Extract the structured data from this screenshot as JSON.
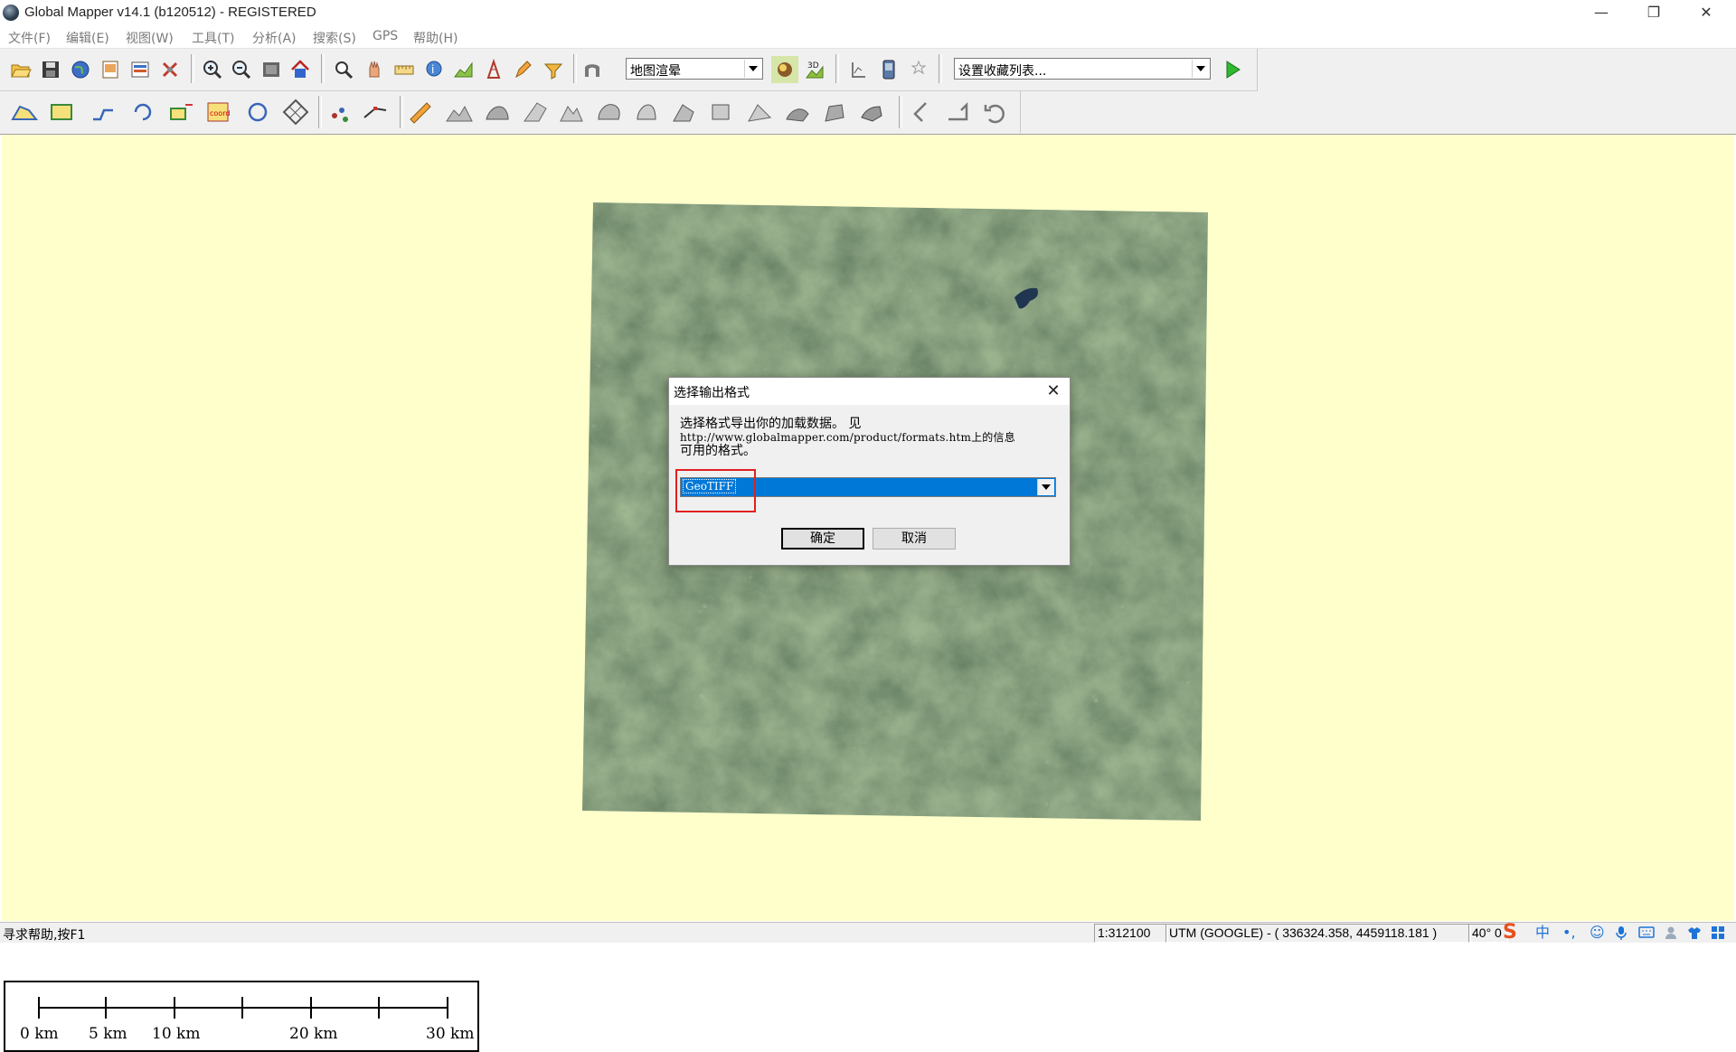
{
  "window": {
    "title": "Global Mapper v14.1 (b120512) - REGISTERED",
    "minimize": "—",
    "restore": "❐",
    "close": "✕"
  },
  "menu": [
    "文件(F)",
    "编辑(E)",
    "视图(W)",
    "工具(T)",
    "分析(A)",
    "搜索(S)",
    "GPS",
    "帮助(H)"
  ],
  "toolbar": {
    "render_combo": "地图渲晕",
    "favorites_combo": "设置收藏列表..."
  },
  "scalebar": {
    "labels": [
      "0 km",
      "5 km",
      "10 km",
      "20 km",
      "30 km"
    ]
  },
  "dialog": {
    "title": "选择输出格式",
    "message_line1": "选择格式导出你的加载数据。 见",
    "message_line2": "http://www.globalmapper.com/product/formats.htm上的信息",
    "message_line3": "可用的格式。",
    "selected_format": "GeoTIFF",
    "ok_label": "确定",
    "cancel_label": "取消",
    "close": "✕"
  },
  "status": {
    "help_text": "寻求帮助,按F1",
    "scale": "1:312100",
    "projection_coords": "UTM (GOOGLE) - ( 336324.358, 4459118.181 )",
    "latlon": "40° 0"
  },
  "tray": {
    "ime_logo": "S",
    "ime_lang": "中",
    "punct": "•,",
    "emoji": "☺"
  },
  "colors": {
    "canvas_bg": "#ffffcc",
    "selection_blue": "#0078d7",
    "highlight_red": "#e02020"
  }
}
